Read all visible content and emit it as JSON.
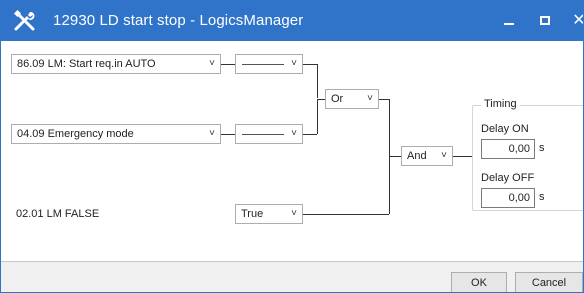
{
  "window": {
    "title": "12930 LD start stop - LogicsManager",
    "icon": "tools-icon",
    "titlebar_color": "#2f74c9"
  },
  "logic": {
    "input1": "86.09 LM: Start req.in AUTO",
    "input2": "04.09 Emergency mode",
    "input3": "02.01 LM FALSE",
    "op1": "",
    "op2": "",
    "op3": "True",
    "gate1": "Or",
    "gate2": "And"
  },
  "timing": {
    "title": "Timing",
    "delay_on_label": "Delay ON",
    "delay_on_value": "0,00",
    "delay_on_unit": "s",
    "delay_off_label": "Delay OFF",
    "delay_off_value": "0,00",
    "delay_off_unit": "s"
  },
  "buttons": {
    "ok": "OK",
    "cancel": "Cancel"
  }
}
